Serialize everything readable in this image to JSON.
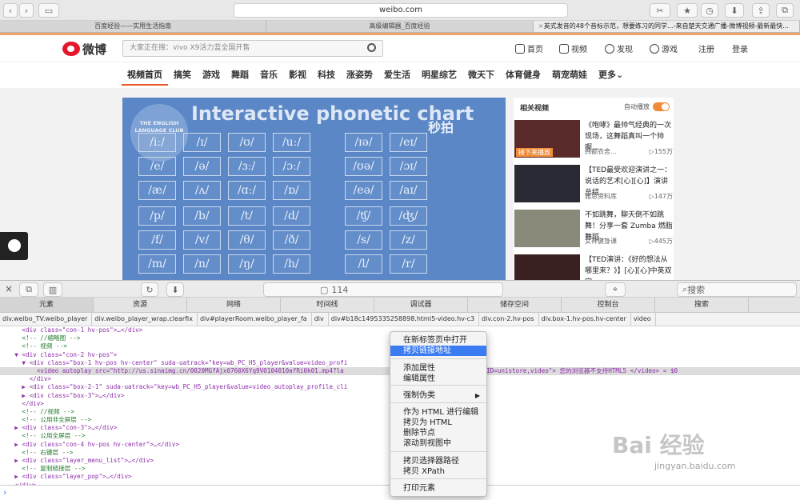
{
  "browser": {
    "url": "weibo.com",
    "tabs": [
      "百度经验——实用生活指南",
      "高级编辑器_百度经验",
      "英式发音的48个音标示范，想要练习的同学...-来自楚天交通广播-微博视频-最新最快..."
    ]
  },
  "weibo": {
    "logo_text": "微博",
    "search_placeholder": "大家正在搜：vivo X9活力蓝全国开售",
    "nav": [
      {
        "label": "首页",
        "icon": "home-icon"
      },
      {
        "label": "视频",
        "icon": "video-icon"
      },
      {
        "label": "发现",
        "icon": "compass-icon"
      },
      {
        "label": "游戏",
        "icon": "gamepad-icon"
      }
    ],
    "register": "注册",
    "login": "登录",
    "categories": [
      "视频首页",
      "搞笑",
      "游戏",
      "舞蹈",
      "音乐",
      "影视",
      "科技",
      "涨姿势",
      "爱生活",
      "明星综艺",
      "微天下",
      "体育健身",
      "萌宠萌娃",
      "更多⌄"
    ]
  },
  "video": {
    "title": "Interactive phonetic chart",
    "club": "THE ENGLISH LANGUAGE CLUB",
    "watermark": "秒拍",
    "symbols": [
      "/iː/",
      "/ɪ/",
      "/ʊ/",
      "/uː/",
      "/ɪə/",
      "/eɪ/",
      "/e/",
      "/ə/",
      "/ɜː/",
      "/ɔː/",
      "/ʊə/",
      "/ɔɪ/",
      "/æ/",
      "/ʌ/",
      "/ɑː/",
      "/ɒ/",
      "/eə/",
      "/aɪ/",
      "/p/",
      "/b/",
      "/t/",
      "/d/",
      "/ʧ/",
      "/ʤ/",
      "/f/",
      "/v/",
      "/θ/",
      "/ð/",
      "/s/",
      "/z/",
      "/m/",
      "/n/",
      "/ŋ/",
      "/h/",
      "/l/",
      "/r/"
    ]
  },
  "related": {
    "heading": "相关视频",
    "autoplay": "自动播放",
    "items": [
      {
        "title": "《咆哮》最帅气经典的一次现场，这舞蹈真叫一个帅啊...",
        "author": "韩都衣舍...",
        "views": "▷155万",
        "badge": "接下来播放"
      },
      {
        "title": "【TED最受欢迎演讲之一：说话的艺术[心][心]】演讲总结...",
        "author": "雅思资料库",
        "views": "▷147万",
        "badge": ""
      },
      {
        "title": "不如跳舞，聊天倒不如跳舞！分享一套 Zumba 燃脂舞蹈...",
        "author": "女神健身课",
        "views": "▷445万",
        "badge": ""
      },
      {
        "title": "【TED演讲：《好的想法从哪里来？》】[心][心]中英双字...",
        "author": "",
        "views": "",
        "badge": ""
      }
    ]
  },
  "devtools": {
    "tabs": [
      "元素",
      "资源",
      "网络",
      "时间线",
      "调试器",
      "储存空间",
      "控制台",
      "搜索"
    ],
    "resource_count": "114",
    "search_placeholder": "搜索",
    "crumbs": [
      "div.weibo_TV.weibo_player",
      "div.weibo_player_wrap.clearfix",
      "div#playerRoom.weibo_player_fa",
      "div",
      "div#b18c1495335258898.html5-video.hv-c3",
      "div.con-2.hv-pos",
      "div.box-1.hv-pos.hv-center",
      "video"
    ],
    "dom_lines": [
      "      <div class=\"con-1 hv-pos\">…</div>",
      "      <!-- //缩略图 -->",
      "      <!-- 视频 -->",
      "    ▼ <div class=\"con-2 hv-pos\">",
      "      ▼ <div class=\"box-1 hv-pos hv-center\" suda-uatrack=\"key=wb_PC_H5_player&value=video_profi",
      "          <video autoplay src=\"http://us.sinaimg.cn/0020MGfAjx0760X6Yq9V0104010afRi0k01.mp4?la                 6861&ssig=8qOwa11Ucp&KID=unistore,video\"> 您的浏览器不支持HTML5 </video> = $0",
      "        </div>",
      "      ▶ <div class=\"box-2-1\" suda-uatrack=\"key=wb_PC_H5_player&value=video_autoplay_profile_cli",
      "      ▶ <div class=\"box-3\">…</div>",
      "      </div>",
      "      <!-- //视频 -->",
      "      <!-- 公用非全屏层 -->",
      "    ▶ <div class=\"con-3\">…</div>",
      "      <!-- 公用全屏层 -->",
      "    ▶ <div class=\"con-4 hv-pos hv-center\">…</div>",
      "      <!-- 右键层 -->",
      "    ▶ <div class=\"layer_menu_list\">…</div>",
      "      <!-- 复制链接层 -->",
      "    ▶ <div class=\"layer_pop\">…</div>",
      "    </div>"
    ],
    "console_prompt": "›"
  },
  "context_menu": {
    "items": [
      "在新标签页中打开",
      "拷贝链接地址",
      "添加属性",
      "编辑属性",
      "强制伪类",
      "作为 HTML 进行编辑",
      "拷贝为 HTML",
      "删除节点",
      "滚动到视图中",
      "拷贝选择器路径",
      "拷贝 XPath",
      "打印元素"
    ],
    "highlighted": "拷贝链接地址"
  },
  "overlay": {
    "watermark": "Bai 经验",
    "watermark_url": "jingyan.baidu.com"
  }
}
